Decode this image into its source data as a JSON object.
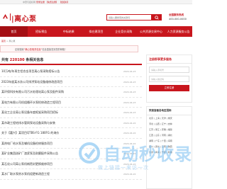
{
  "topbar": {
    "prefix": "中登与招标网",
    "link1": "登录注册",
    "link2": "【免费注册】",
    "link3": "【经招标】"
  },
  "header": {
    "logo_text": "|离心泵",
    "search_placeholder": "请输入要搜索的关键词",
    "hotline_label": "全国服务热线",
    "hotline_number": "400-000-0000"
  },
  "nav": {
    "items": [
      {
        "label": "首页"
      },
      {
        "label": "招标预告"
      },
      {
        "label": "中标结果"
      },
      {
        "label": "拟在建项目"
      },
      {
        "label": "企业竞价采购"
      },
      {
        "label": "公共资源交易中心"
      },
      {
        "label": "人力资源服务公告"
      }
    ]
  },
  "breadcrumb": {
    "home": "首页",
    "sep": " > ",
    "current": "离心泵"
  },
  "banner": {
    "prefix": "定制搜索",
    "emphasis": "“离心泵相关信息”",
    "suffix": "信息直接发到您的邮箱！"
  },
  "listhead": {
    "prefix": "共有",
    "count": "220100",
    "suffix": "条相关信息"
  },
  "list": [
    {
      "title": "10万吨/年再生铝合金项目离心泵采购招标公告",
      "date": "2024-04-23"
    },
    {
      "title": "2023年度某水务公司排涝泵站设备维修改造项目",
      "date": "2024-04-23"
    },
    {
      "title": "某环保科技有限公司污水处理站离心泵及配件采购",
      "date": "2024-04-23"
    },
    {
      "title": "某电力有限公司机组循环水泵检修改造工程项目",
      "date": "2024-04-23"
    },
    {
      "title": "某化工企业离心泵设备年度框架采购项目招标",
      "date": "2024-04-23"
    },
    {
      "title": "某市政工程给排水管网泵站设备采购与安装",
      "date": "2024-04-22"
    },
    {
      "title": "关于【嘉兴】某项目QTBS-FG 180FG 的询价",
      "date": "2024-04-22"
    },
    {
      "title": "某热电厂给水泵及辅机设备检修服务项目",
      "date": "2024-04-22"
    },
    {
      "title": "某矿业集团选矿厂渣浆泵及耐磨配件采购公告",
      "date": "2024-04-22"
    },
    {
      "title": "某石化公司离心泵机械密封更换维修项目",
      "date": "2024-04-22"
    },
    {
      "title": "某水厂取水泵房水泵机组更新改造工程",
      "date": "2024-04-22"
    }
  ],
  "side": {
    "title": "注册即享更多服务",
    "field1": "请输入手机号",
    "field2": "请输入验证码",
    "button": "立即注册"
  },
  "side2": {
    "title": "快速查看各地区招标",
    "items": [
      "北京 | 上海 | 天津 | 重庆",
      "河北 | 山西 | 辽宁 | 吉林",
      "江苏 | 浙江 | 安徽 | 福建",
      "江西 | 山东 | 河南 | 湖北",
      "湖南 | 广东 | 广西 | 海南",
      "四川 | 贵州 | 云南 | 陕西",
      "甘肃 | 青海 | 宁夏 | 新疆"
    ]
  },
  "watermark": {
    "big": "自动秒收录",
    "small": "做上链接一来访一次"
  },
  "colors": {
    "brand": "#c8161d",
    "watermark": "#78bef0"
  }
}
